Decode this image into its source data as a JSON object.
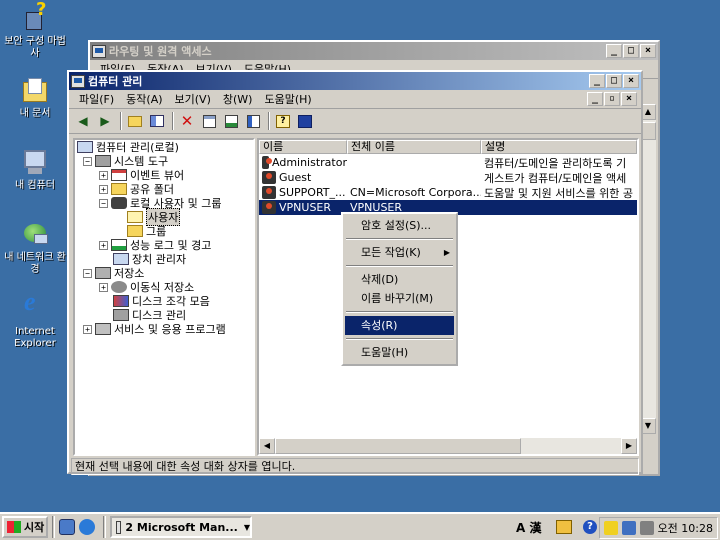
{
  "desktop": {
    "icons": [
      {
        "label": "보안 구성 마법사"
      },
      {
        "label": "내 문서"
      },
      {
        "label": "내 컴퓨터"
      },
      {
        "label": "내 네트워크 환경"
      },
      {
        "label": "Internet Explorer"
      }
    ]
  },
  "bg_window": {
    "title": "라우팅 및 원격 액세스",
    "menu": [
      "파일(F)",
      "동작(A)",
      "보기(V)",
      "도움말(H)"
    ]
  },
  "main_window": {
    "title": "컴퓨터 관리",
    "menu": [
      "파일(F)",
      "동작(A)",
      "보기(V)",
      "창(W)",
      "도움말(H)"
    ],
    "tree": [
      {
        "label": "컴퓨터 관리(로컬)"
      },
      {
        "label": "시스템 도구"
      },
      {
        "label": "이벤트 뷰어"
      },
      {
        "label": "공유 폴더"
      },
      {
        "label": "로컬 사용자 및 그룹"
      },
      {
        "label": "사용자"
      },
      {
        "label": "그룹"
      },
      {
        "label": "성능 로그 및 경고"
      },
      {
        "label": "장치 관리자"
      },
      {
        "label": "저장소"
      },
      {
        "label": "이동식 저장소"
      },
      {
        "label": "디스크 조각 모음"
      },
      {
        "label": "디스크 관리"
      },
      {
        "label": "서비스 및 응용 프로그램"
      }
    ],
    "columns": [
      "이름",
      "전체 이름",
      "설명"
    ],
    "rows": [
      {
        "name": "Administrator",
        "full": "",
        "desc": "컴퓨터/도메인을 관리하도록 기"
      },
      {
        "name": "Guest",
        "full": "",
        "desc": "게스트가 컴퓨터/도메인을 액세"
      },
      {
        "name": "SUPPORT_...",
        "full": "CN=Microsoft Corpora...",
        "desc": "도움말 및 지원 서비스를 위한 공"
      },
      {
        "name": "VPNUSER",
        "full": "VPNUSER",
        "desc": ""
      }
    ],
    "status": "현재 선택 내용에 대한 속성 대화 상자를 엽니다."
  },
  "context_menu": {
    "items": [
      "암호 설정(S)...",
      "모든 작업(K)",
      "삭제(D)",
      "이름 바꾸기(M)",
      "속성(R)",
      "도움말(H)"
    ]
  },
  "taskbar": {
    "start": "시작",
    "task": "2 Microsoft Man...",
    "clock": "오전 10:28",
    "ime": "A 漢"
  }
}
